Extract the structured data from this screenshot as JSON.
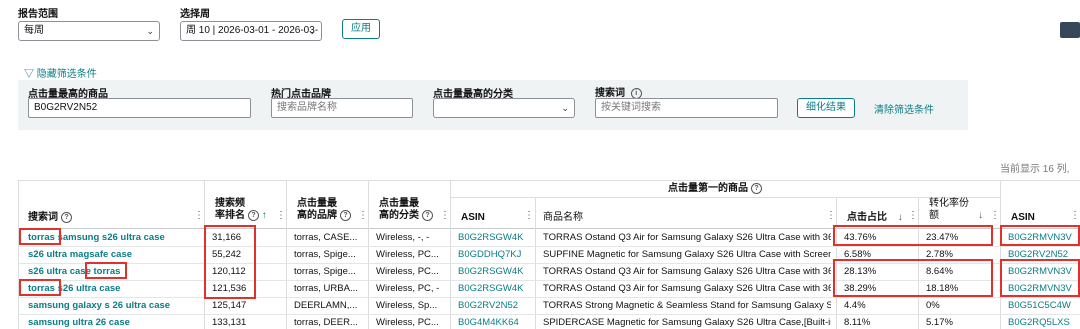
{
  "top": {
    "report_range_label": "报告范围",
    "report_range_value": "每周",
    "select_week_label": "选择周",
    "select_week_value": "周 10 | 2026-03-01 - 2026-03-",
    "apply_button": "应用"
  },
  "filters": {
    "toggle_label": "隐藏筛选条件",
    "most_clicked_product_label": "点击量最高的商品",
    "most_clicked_product_value": "B0G2RV2N52",
    "hot_brand_label": "热门点击品牌",
    "hot_brand_placeholder": "搜索品牌名称",
    "top_category_label": "点击量最高的分类",
    "search_term_label": "搜索词",
    "search_term_placeholder": "按关键词搜索",
    "refine_button": "细化结果",
    "clear_link": "清除筛选条件"
  },
  "showing_text": "当前显示 16 列,",
  "table": {
    "group_header": "点击量第一的商品",
    "headers": {
      "search_term": "搜索词",
      "search_freq_rank_1": "搜索频",
      "search_freq_rank_2": "率排名",
      "top_brand_1": "点击量最",
      "top_brand_2": "高的品牌",
      "top_category_1": "点击量最",
      "top_category_2": "高的分类",
      "asin": "ASIN",
      "product_name": "商品名称",
      "click_share": "点击占比",
      "conversion_share_1": "转化率份",
      "conversion_share_2": "额",
      "asin2": "ASIN"
    },
    "rows": [
      {
        "term_a": "torras",
        "term_b": " samsung s26 ultra case",
        "rank": "31,166",
        "brand": "torras, CASE...",
        "category": "Wireless, -, -",
        "asin": "B0G2RSGW4K",
        "product": "TORRAS Ostand Q3 Air for Samsung Galaxy S26 Ultra Case with 36...",
        "click": "43.76%",
        "conv": "23.47%",
        "asin2": "B0G2RMVN3V"
      },
      {
        "term_a": "s26 ultra magsafe case",
        "term_b": "",
        "rank": "55,242",
        "brand": "torras, Spige...",
        "category": "Wireless, PC...",
        "asin": "B0GDDHQ7KJ",
        "product": "SUPFINE Magnetic for Samsung Galaxy S26 Ultra Case with Screen ...",
        "click": "6.58%",
        "conv": "2.78%",
        "asin2": "B0G2RV2N52"
      },
      {
        "term_a": "s26 ultra case ",
        "term_b": "torras",
        "rank": "120,112",
        "brand": "torras, Spige...",
        "category": "Wireless, PC...",
        "asin": "B0G2RSGW4K",
        "product": "TORRAS Ostand Q3 Air for Samsung Galaxy S26 Ultra Case with 36...",
        "click": "28.13%",
        "conv": "8.64%",
        "asin2": "B0G2RMVN3V"
      },
      {
        "term_a": "torras",
        "term_b": " s26 ultra case",
        "rank": "121,536",
        "brand": "torras, URBA...",
        "category": "Wireless, PC, -",
        "asin": "B0G2RSGW4K",
        "product": "TORRAS Ostand Q3 Air for Samsung Galaxy S26 Ultra Case with 36...",
        "click": "38.29%",
        "conv": "18.18%",
        "asin2": "B0G2RMVN3V"
      },
      {
        "term_a": "samsung galaxy s 26 ultra case",
        "term_b": "",
        "rank": "125,147",
        "brand": "DEERLAMN,...",
        "category": "Wireless, Sp...",
        "asin": "B0G2RV2N52",
        "product": "TORRAS Strong Magnetic & Seamless Stand for Samsung Galaxy S...",
        "click": "4.4%",
        "conv": "0%",
        "asin2": "B0G51C5C4W"
      },
      {
        "term_a": "samsung ultra 26 case",
        "term_b": "",
        "rank": "133,131",
        "brand": "torras, DEER...",
        "category": "Wireless, PC...",
        "asin": "B0G4M4KK64",
        "product": "SPIDERCASE Magnetic for Samsung Galaxy S26 Ultra Case,[Built-in...",
        "click": "8.11%",
        "conv": "5.17%",
        "asin2": "B0G2RQ5LXS"
      }
    ]
  },
  "colors": {
    "accent": "#0b7d86",
    "highlight": "#e0312b",
    "dark": "#37475a"
  }
}
